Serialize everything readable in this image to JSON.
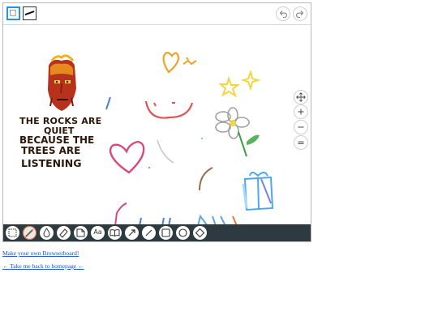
{
  "toolbar_top": {
    "left_tools": [
      {
        "icon": "white-square-icon",
        "selected": true
      },
      {
        "icon": "pen-stroke-icon",
        "selected": false
      }
    ],
    "right_tools": [
      {
        "icon": "undo-icon"
      },
      {
        "icon": "redo-icon"
      }
    ]
  },
  "canvas": {
    "handwritten_text": [
      "THE ROCKS ARE",
      "QUIET",
      "BECAUSE THE",
      "TREES ARE",
      "LISTENING"
    ]
  },
  "side_controls": [
    {
      "icon": "move-icon"
    },
    {
      "icon": "zoom-in-icon"
    },
    {
      "icon": "zoom-out-icon"
    },
    {
      "icon": "zoom-reset-icon"
    }
  ],
  "bottom_tools": [
    {
      "icon": "select-icon"
    },
    {
      "icon": "pencil-icon"
    },
    {
      "icon": "fill-drop-icon"
    },
    {
      "icon": "eraser-icon"
    },
    {
      "icon": "note-icon"
    },
    {
      "icon": "text-icon",
      "label": "Aa"
    },
    {
      "icon": "book-icon"
    },
    {
      "icon": "arrow-icon"
    },
    {
      "icon": "line-icon"
    },
    {
      "icon": "rectangle-icon"
    },
    {
      "icon": "ellipse-icon"
    },
    {
      "icon": "diamond-icon"
    }
  ],
  "links": {
    "make_board": "Make your own Browserboard!",
    "back_home": "← Take me back to homepage ←"
  },
  "colors": {
    "toolbar_bg": "#2d3a40",
    "selected_accent": "#2d8fe0",
    "link": "#1a4fd6"
  }
}
